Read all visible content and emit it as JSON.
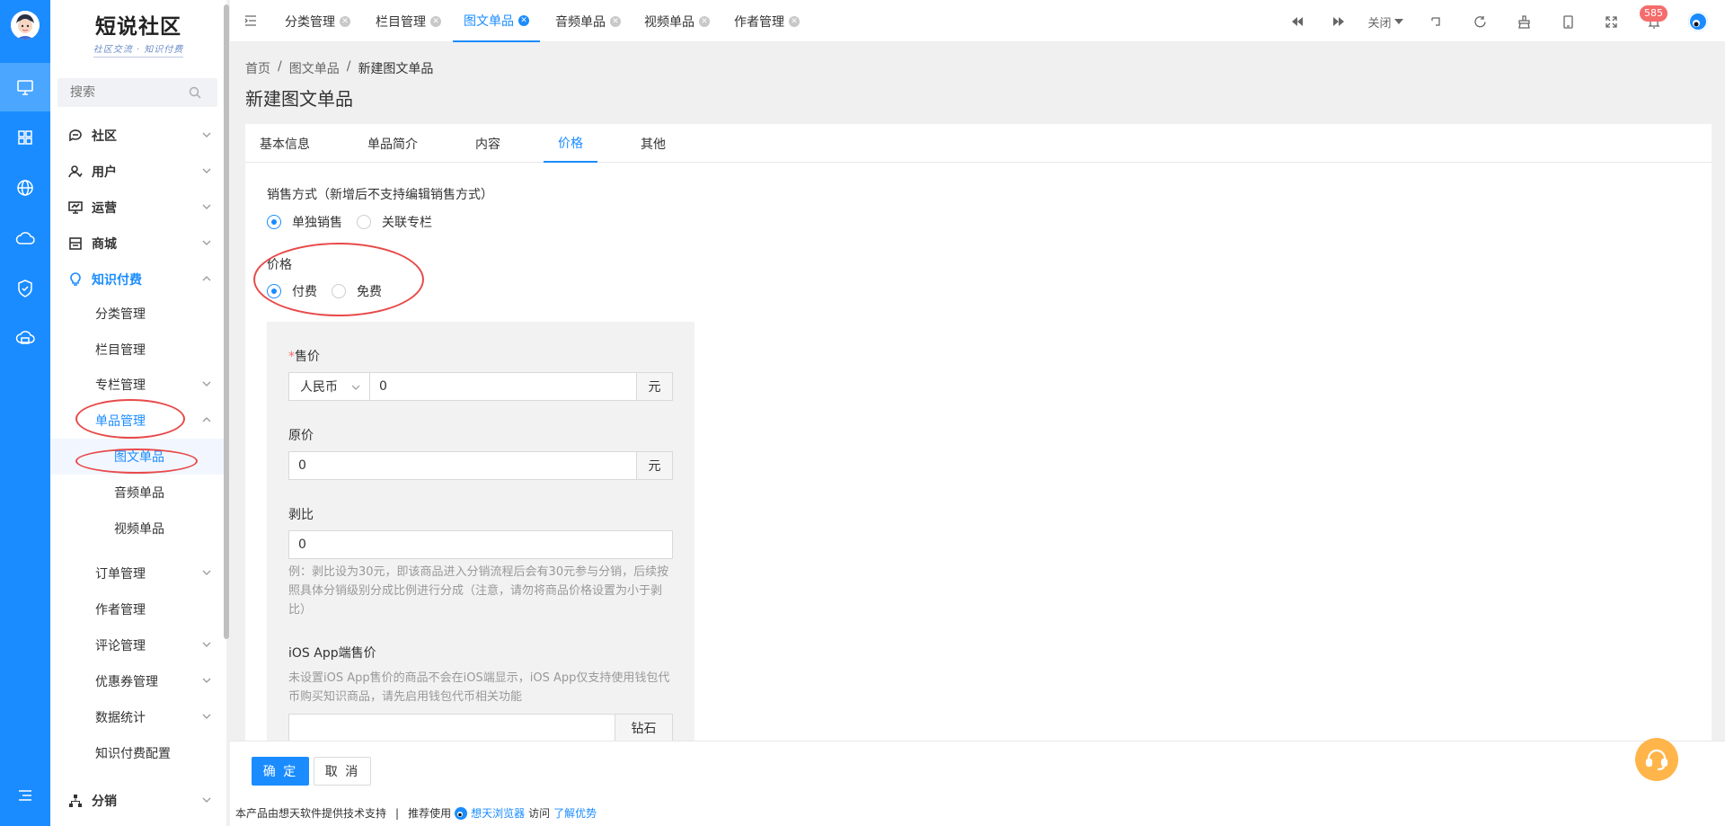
{
  "logo": {
    "title": "短说社区",
    "subtitle": "社区交流 · 知识付费"
  },
  "search": {
    "placeholder": "搜索"
  },
  "menu": [
    {
      "label": "社区",
      "icon": "chat-icon"
    },
    {
      "label": "用户",
      "icon": "user-icon"
    },
    {
      "label": "运营",
      "icon": "monitor-chart-icon"
    },
    {
      "label": "商城",
      "icon": "shop-icon"
    },
    {
      "label": "知识付费",
      "icon": "bulb-icon"
    },
    {
      "label": "分类管理"
    },
    {
      "label": "栏目管理"
    },
    {
      "label": "专栏管理"
    },
    {
      "label": "单品管理"
    },
    {
      "label": "图文单品"
    },
    {
      "label": "音频单品"
    },
    {
      "label": "视频单品"
    },
    {
      "label": "订单管理"
    },
    {
      "label": "作者管理"
    },
    {
      "label": "评论管理"
    },
    {
      "label": "优惠券管理"
    },
    {
      "label": "数据统计"
    },
    {
      "label": "知识付费配置"
    },
    {
      "label": "分销",
      "icon": "org-icon"
    }
  ],
  "tabs": [
    {
      "label": "分类管理"
    },
    {
      "label": "栏目管理"
    },
    {
      "label": "图文单品"
    },
    {
      "label": "音频单品"
    },
    {
      "label": "视频单品"
    },
    {
      "label": "作者管理"
    }
  ],
  "toolbar": {
    "close_label": "关闭",
    "badge": "585"
  },
  "breadcrumb": [
    "首页",
    "图文单品",
    "新建图文单品"
  ],
  "page_title": "新建图文单品",
  "form_tabs": [
    "基本信息",
    "单品简介",
    "内容",
    "价格",
    "其他"
  ],
  "sale": {
    "label": "销售方式（新增后不支持编辑销售方式）",
    "opt1": "单独销售",
    "opt2": "关联专栏",
    "selected": "单独销售"
  },
  "price_type": {
    "label": "价格",
    "opt1": "付费",
    "opt2": "免费",
    "selected": "付费"
  },
  "price": {
    "sale_label": "售价",
    "required_mark": "*",
    "currency": "人民币",
    "sale_value": "0",
    "unit": "元",
    "orig_label": "原价",
    "orig_value": "0",
    "rebate_label": "剥比",
    "rebate_value": "0",
    "rebate_help": "例：剥比设为30元，即该商品进入分销流程后会有30元参与分销，后续按照具体分销级别分成比例进行分成（注意，请勿将商品价格设置为小于剥比）",
    "ios_label": "iOS App端售价",
    "ios_help": "未设置iOS App售价的商品不会在iOS端显示，iOS App仅支持使用钱包代币购买知识商品，请先启用钱包代币相关功能",
    "ios_value": "",
    "ios_unit": "钻石"
  },
  "buttons": {
    "ok": "确 定",
    "cancel": "取 消"
  },
  "footer": {
    "text1": "本产品由想天软件提供技术支持",
    "sep": "|",
    "text2": "推荐使用",
    "browser": "想天浏览器",
    "text3": "访问",
    "link": "了解优势"
  },
  "colors": {
    "primary": "#1a8cff",
    "annotation": "#e84a4a",
    "badge": "#f56c6c"
  }
}
